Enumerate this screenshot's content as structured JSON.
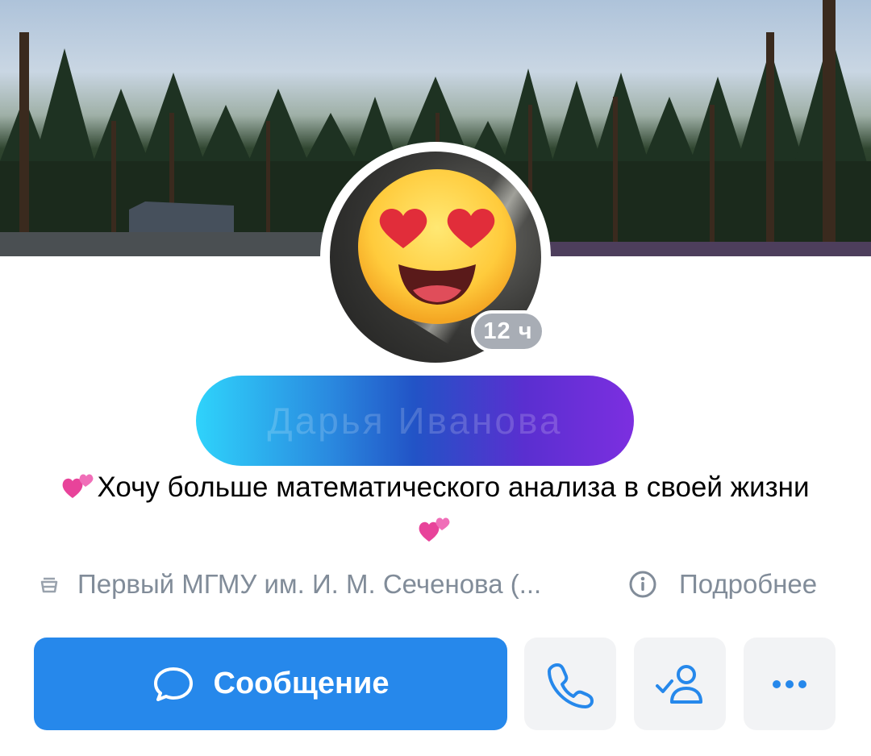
{
  "profile": {
    "name": "Дарья Иванова",
    "story_age": "12 ч",
    "status_text": "Хочу больше математического анализа в своей жизни",
    "education": "Первый МГМУ им. И. М. Сеченова (...",
    "details_label": "Подробнее"
  },
  "actions": {
    "message_label": "Сообщение",
    "call_icon": "phone-icon",
    "friend_icon": "user-check-icon",
    "more_icon": "more-horizontal-icon"
  },
  "colors": {
    "primary": "#2688eb",
    "secondary_bg": "#f2f3f5",
    "muted_text": "#818c99",
    "badge_bg": "#a8adb5"
  }
}
